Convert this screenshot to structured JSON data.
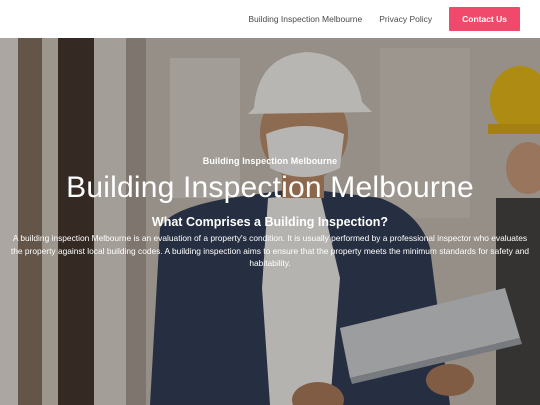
{
  "header": {
    "nav_links": [
      "Building Inspection Melbourne",
      "Privacy Policy"
    ],
    "cta_label": "Contact Us",
    "cta_color": "#f0496b"
  },
  "hero": {
    "eyebrow": "Building Inspection Melbourne",
    "title": "Building Inspection Melbourne",
    "subtitle": "What Comprises a Building Inspection?",
    "body": "A building inspection Melbourne is an evaluation of a property's condition. It is usually performed by a professional inspector who evaluates the property against local building codes. A building inspection aims to ensure that the property meets the minimum standards for safety and habitability."
  }
}
